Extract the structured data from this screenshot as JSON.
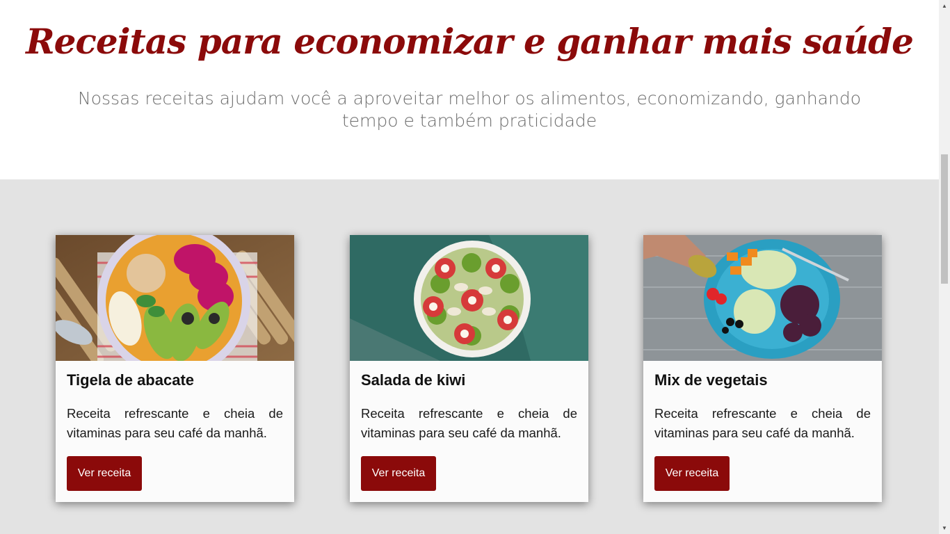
{
  "hero": {
    "title": "Receitas para economizar e ganhar mais saúde",
    "subtitle": "Nossas receitas ajudam você a aproveitar melhor os alimentos, economizando, ganhando tempo e também praticidade"
  },
  "cards": [
    {
      "image_icon": "avocado-bowl-image",
      "title": "Tigela de abacate",
      "text": "Receita refrescante e cheia de vitaminas para seu café da manhã.",
      "button": "Ver receita"
    },
    {
      "image_icon": "kiwi-salad-image",
      "title": "Salada de kiwi",
      "text": "Receita refrescante e cheia de vitaminas para seu café da manhã.",
      "button": "Ver receita"
    },
    {
      "image_icon": "vegetable-mix-image",
      "title": "Mix de vegetais",
      "text": "Receita refrescante e cheia de vitaminas para seu café da manhã.",
      "button": "Ver receita"
    }
  ],
  "colors": {
    "accent": "#8b0a0a",
    "section_bg": "#e3e3e3",
    "subtitle": "#6d6d6d"
  }
}
